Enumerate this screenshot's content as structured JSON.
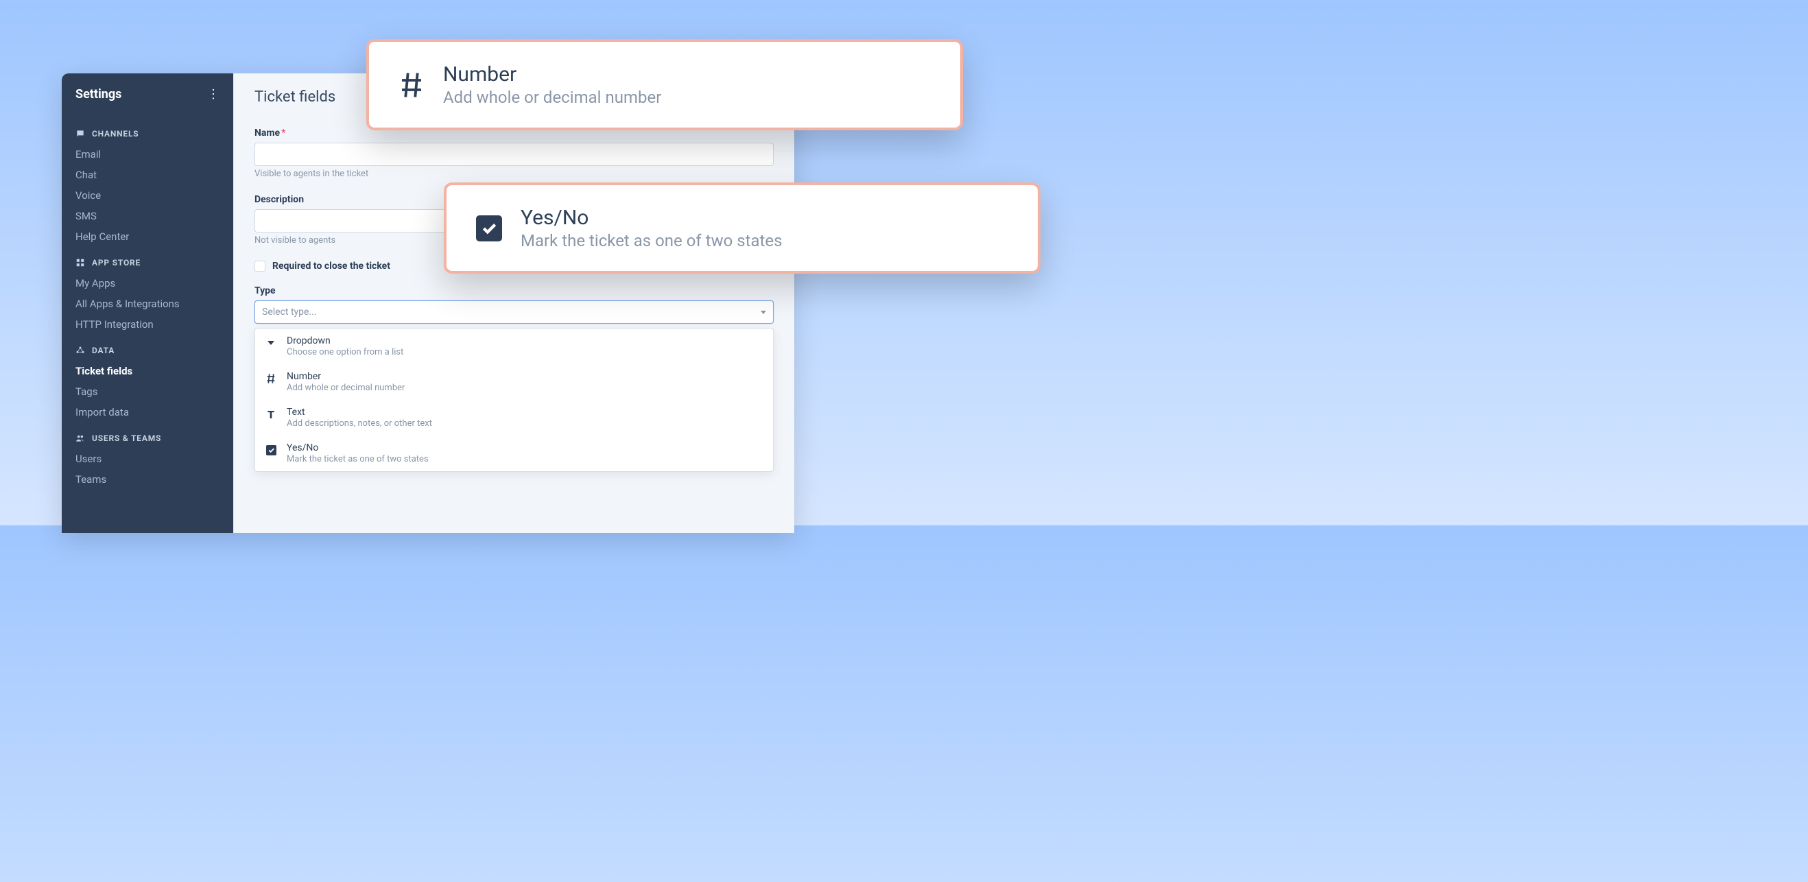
{
  "sidebar": {
    "title": "Settings",
    "sections": [
      {
        "label": "CHANNELS",
        "items": [
          "Email",
          "Chat",
          "Voice",
          "SMS",
          "Help Center"
        ]
      },
      {
        "label": "APP STORE",
        "items": [
          "My Apps",
          "All Apps & Integrations",
          "HTTP Integration"
        ]
      },
      {
        "label": "DATA",
        "items": [
          "Ticket fields",
          "Tags",
          "Import data"
        ]
      },
      {
        "label": "USERS & TEAMS",
        "items": [
          "Users",
          "Teams"
        ]
      }
    ]
  },
  "main": {
    "page_title": "Ticket fields",
    "name_label": "Name",
    "name_helper": "Visible to agents in the ticket",
    "desc_label": "Description",
    "desc_helper": "Not visible to agents",
    "required_checkbox_label": "Required to close the ticket",
    "type_label": "Type",
    "type_placeholder": "Select type...",
    "type_options": [
      {
        "title": "Dropdown",
        "desc": "Choose one option from a list"
      },
      {
        "title": "Number",
        "desc": "Add whole or decimal number"
      },
      {
        "title": "Text",
        "desc": "Add descriptions, notes, or other text"
      },
      {
        "title": "Yes/No",
        "desc": "Mark the ticket as one of two states"
      }
    ]
  },
  "detail_cards": {
    "number": {
      "title": "Number",
      "desc": "Add whole or decimal number"
    },
    "yesno": {
      "title": "Yes/No",
      "desc": "Mark the ticket as one of two states"
    }
  }
}
